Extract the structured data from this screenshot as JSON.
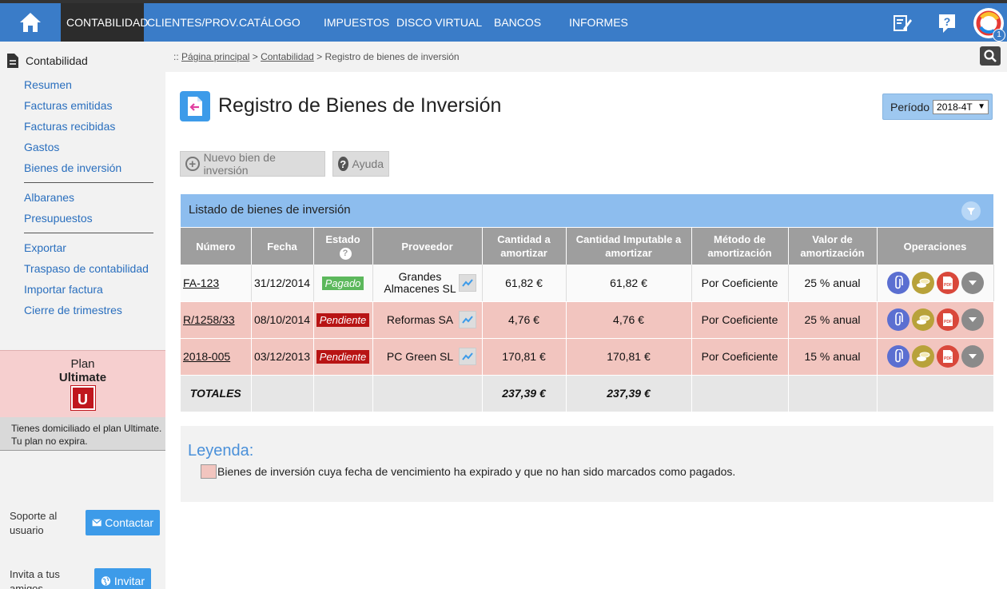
{
  "nav": {
    "items": [
      "CONTABILIDAD",
      "CLIENTES/PROV.",
      "CATÁLOGO",
      "IMPUESTOS",
      "DISCO VIRTUAL",
      "BANCOS",
      "INFORMES"
    ],
    "active": "CONTABILIDAD",
    "notifications": "1"
  },
  "sidebar": {
    "title": "Contabilidad",
    "group1": [
      "Resumen",
      "Facturas emitidas",
      "Facturas recibidas",
      "Gastos",
      "Bienes de inversión"
    ],
    "group2": [
      "Albaranes",
      "Presupuestos"
    ],
    "group3": [
      "Exportar",
      "Traspaso de contabilidad",
      "Importar factura",
      "Cierre de trimestres"
    ],
    "plan_label": "Plan",
    "plan_name": "Ultimate",
    "plan_badge": "U",
    "plan_info_1": "Tienes domiciliado el plan Ultimate.",
    "plan_info_2": "Tu plan no expira.",
    "support_1": "Soporte al",
    "support_2": "usuario",
    "contact_label": "Contactar",
    "invite_1": "Invita a tus",
    "invite_2": "amigos",
    "invite_label": "Invitar"
  },
  "breadcrumb": {
    "prefix": ":: ",
    "home": "Página principal",
    "section": "Contabilidad",
    "current": "Registro de bienes de inversión",
    "sep": " > "
  },
  "page": {
    "title": "Registro de Bienes de Inversión",
    "period_label": "Período",
    "period_value": "2018-4T",
    "new_button": "Nuevo bien de inversión",
    "help_button": "Ayuda"
  },
  "table": {
    "title": "Listado de bienes de inversión",
    "headers": [
      "Número",
      "Fecha",
      "Estado",
      "Proveedor",
      "Cantidad a amortizar",
      "Cantidad Imputable a amortizar",
      "Método de amortización",
      "Valor de amortización",
      "Operaciones"
    ],
    "rows": [
      {
        "numero": "FA-123",
        "fecha": "31/12/2014",
        "estado": "Pagado",
        "proveedor": "Grandes Almacenes SL",
        "cantidad": "61,82 €",
        "imputable": "61,82 €",
        "metodo": "Por Coeficiente",
        "valor": "25 % anual"
      },
      {
        "numero": "R/1258/33",
        "fecha": "08/10/2014",
        "estado": "Pendiente",
        "proveedor": "Reformas SA",
        "cantidad": "4,76 €",
        "imputable": "4,76 €",
        "metodo": "Por Coeficiente",
        "valor": "25 % anual"
      },
      {
        "numero": "2018-005",
        "fecha": "03/12/2013",
        "estado": "Pendiente",
        "proveedor": "PC Green SL",
        "cantidad": "170,81 €",
        "imputable": "170,81 €",
        "metodo": "Por Coeficiente",
        "valor": "15 % anual"
      }
    ],
    "totals_label": "TOTALES",
    "total_cantidad": "237,39 €",
    "total_imputable": "237,39 €"
  },
  "legend": {
    "title": "Leyenda:",
    "text": "Bienes de inversión cuya fecha de vencimiento ha expirado y que no han sido marcados como pagados."
  },
  "colors": {
    "nav_bg": "#3a7cc8",
    "accent": "#3d9be9",
    "late_row": "#f2c5bf",
    "paid": "#5cb85c",
    "pending": "#b81414"
  }
}
